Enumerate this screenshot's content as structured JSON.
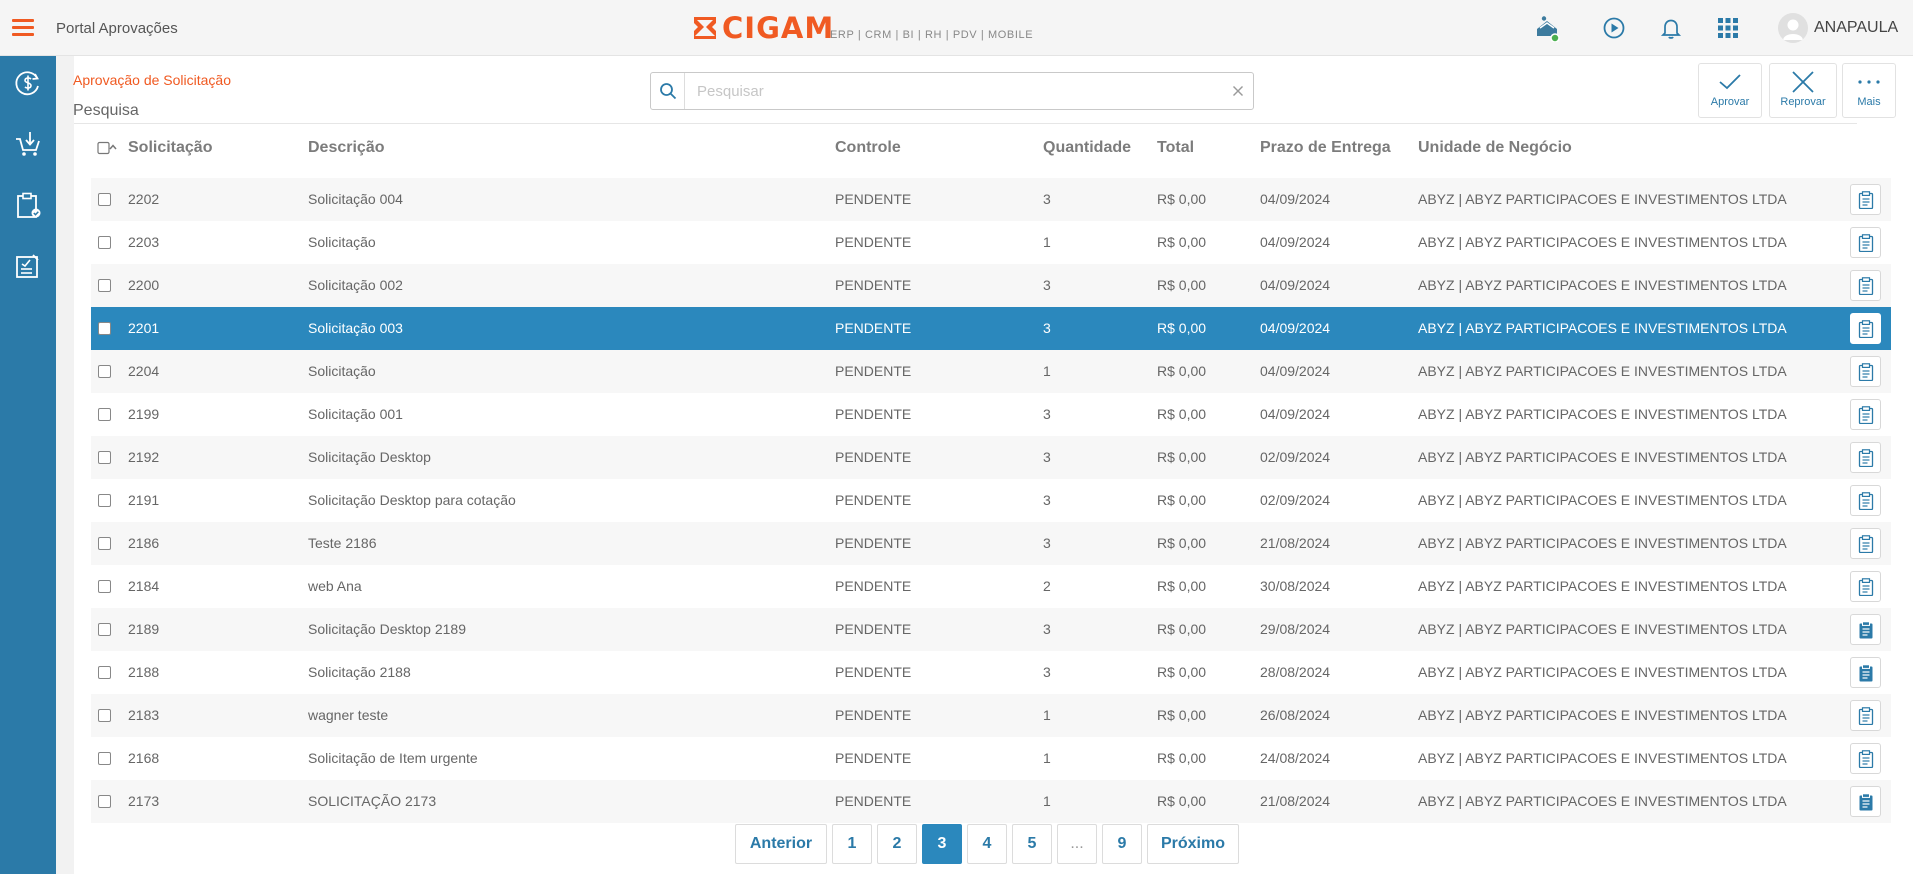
{
  "app": {
    "title": "Portal Aprovações",
    "logo_text": "CIGAM",
    "logo_sub": "ERP | CRM | BI | RH | PDV | MOBILE",
    "brand_color": "#f05a22",
    "primary_color": "#2b7aa8"
  },
  "header": {
    "icons": [
      "messages-icon",
      "play-circle-icon",
      "bell-icon",
      "apps-grid-icon"
    ],
    "user_name": "ANAPAULA"
  },
  "sidebar": {
    "items": [
      "dollar-cycle-icon",
      "cart-download-icon",
      "clipboard-check-icon",
      "report-edit-icon"
    ]
  },
  "breadcrumb": {
    "link": "Aprovação de Solicitação",
    "current": "Pesquisa"
  },
  "search": {
    "placeholder": "Pesquisar",
    "value": ""
  },
  "actions": {
    "approve": "Aprovar",
    "reject": "Reprovar",
    "more": "Mais"
  },
  "table": {
    "columns": {
      "solicitacao": "Solicitação",
      "descricao": "Descrição",
      "controle": "Controle",
      "quantidade": "Quantidade",
      "total": "Total",
      "prazo": "Prazo de Entrega",
      "unidade": "Unidade de Negócio"
    },
    "selected_index": 3,
    "rows": [
      {
        "id": "2202",
        "desc": "Solicitação 004",
        "ctrl": "PENDENTE",
        "qty": "3",
        "total": "R$ 0,00",
        "date": "04/09/2024",
        "unit": "ABYZ | ABYZ PARTICIPACOES E INVESTIMENTOS LTDA",
        "icon": "clipboard-outline-icon"
      },
      {
        "id": "2203",
        "desc": "Solicitação",
        "ctrl": "PENDENTE",
        "qty": "1",
        "total": "R$ 0,00",
        "date": "04/09/2024",
        "unit": "ABYZ | ABYZ PARTICIPACOES E INVESTIMENTOS LTDA",
        "icon": "clipboard-outline-icon"
      },
      {
        "id": "2200",
        "desc": "Solicitação 002",
        "ctrl": "PENDENTE",
        "qty": "3",
        "total": "R$ 0,00",
        "date": "04/09/2024",
        "unit": "ABYZ | ABYZ PARTICIPACOES E INVESTIMENTOS LTDA",
        "icon": "clipboard-outline-icon"
      },
      {
        "id": "2201",
        "desc": "Solicitação 003",
        "ctrl": "PENDENTE",
        "qty": "3",
        "total": "R$ 0,00",
        "date": "04/09/2024",
        "unit": "ABYZ | ABYZ PARTICIPACOES E INVESTIMENTOS LTDA",
        "icon": "clipboard-outline-icon"
      },
      {
        "id": "2204",
        "desc": "Solicitação",
        "ctrl": "PENDENTE",
        "qty": "1",
        "total": "R$ 0,00",
        "date": "04/09/2024",
        "unit": "ABYZ | ABYZ PARTICIPACOES E INVESTIMENTOS LTDA",
        "icon": "clipboard-outline-icon"
      },
      {
        "id": "2199",
        "desc": "Solicitação 001",
        "ctrl": "PENDENTE",
        "qty": "3",
        "total": "R$ 0,00",
        "date": "04/09/2024",
        "unit": "ABYZ | ABYZ PARTICIPACOES E INVESTIMENTOS LTDA",
        "icon": "clipboard-outline-icon"
      },
      {
        "id": "2192",
        "desc": "Solicitação Desktop",
        "ctrl": "PENDENTE",
        "qty": "3",
        "total": "R$ 0,00",
        "date": "02/09/2024",
        "unit": "ABYZ | ABYZ PARTICIPACOES E INVESTIMENTOS LTDA",
        "icon": "clipboard-outline-icon"
      },
      {
        "id": "2191",
        "desc": "Solicitação Desktop para cotação",
        "ctrl": "PENDENTE",
        "qty": "3",
        "total": "R$ 0,00",
        "date": "02/09/2024",
        "unit": "ABYZ | ABYZ PARTICIPACOES E INVESTIMENTOS LTDA",
        "icon": "clipboard-outline-icon"
      },
      {
        "id": "2186",
        "desc": "Teste 2186",
        "ctrl": "PENDENTE",
        "qty": "3",
        "total": "R$ 0,00",
        "date": "21/08/2024",
        "unit": "ABYZ | ABYZ PARTICIPACOES E INVESTIMENTOS LTDA",
        "icon": "clipboard-outline-icon"
      },
      {
        "id": "2184",
        "desc": "web Ana",
        "ctrl": "PENDENTE",
        "qty": "2",
        "total": "R$ 0,00",
        "date": "30/08/2024",
        "unit": "ABYZ | ABYZ PARTICIPACOES E INVESTIMENTOS LTDA",
        "icon": "clipboard-outline-icon"
      },
      {
        "id": "2189",
        "desc": "Solicitação Desktop 2189",
        "ctrl": "PENDENTE",
        "qty": "3",
        "total": "R$ 0,00",
        "date": "29/08/2024",
        "unit": "ABYZ | ABYZ PARTICIPACOES E INVESTIMENTOS LTDA",
        "icon": "clipboard-filled-icon"
      },
      {
        "id": "2188",
        "desc": "Solicitação 2188",
        "ctrl": "PENDENTE",
        "qty": "3",
        "total": "R$ 0,00",
        "date": "28/08/2024",
        "unit": "ABYZ | ABYZ PARTICIPACOES E INVESTIMENTOS LTDA",
        "icon": "clipboard-filled-icon"
      },
      {
        "id": "2183",
        "desc": "wagner teste",
        "ctrl": "PENDENTE",
        "qty": "1",
        "total": "R$ 0,00",
        "date": "26/08/2024",
        "unit": "ABYZ | ABYZ PARTICIPACOES E INVESTIMENTOS LTDA",
        "icon": "clipboard-outline-icon"
      },
      {
        "id": "2168",
        "desc": "Solicitação de Item urgente",
        "ctrl": "PENDENTE",
        "qty": "1",
        "total": "R$ 0,00",
        "date": "24/08/2024",
        "unit": "ABYZ | ABYZ PARTICIPACOES E INVESTIMENTOS LTDA",
        "icon": "clipboard-outline-icon"
      },
      {
        "id": "2173",
        "desc": "SOLICITAÇÃO 2173",
        "ctrl": "PENDENTE",
        "qty": "1",
        "total": "R$ 0,00",
        "date": "21/08/2024",
        "unit": "ABYZ | ABYZ PARTICIPACOES E INVESTIMENTOS LTDA",
        "icon": "clipboard-filled-icon"
      }
    ]
  },
  "pagination": {
    "prev": "Anterior",
    "next": "Próximo",
    "pages": [
      "1",
      "2",
      "3",
      "4",
      "5",
      "...",
      "9"
    ],
    "current": "3"
  }
}
